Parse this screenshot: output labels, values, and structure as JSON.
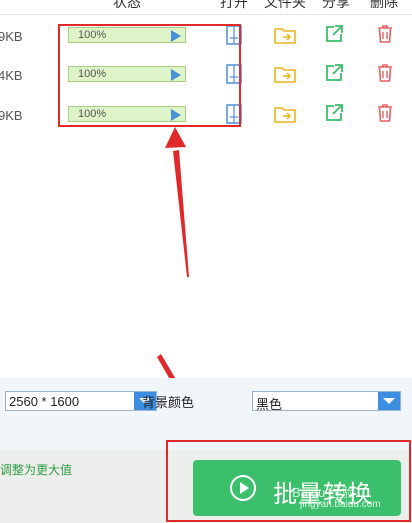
{
  "header": {
    "col_status": "状态",
    "col_open": "打开",
    "col_folder": "文件夹",
    "col_share": "分享",
    "col_delete": "删除"
  },
  "rows": [
    {
      "size": "9KB",
      "progress_text": "100%",
      "progress": 1.0
    },
    {
      "size": "4KB",
      "progress_text": "100%",
      "progress": 1.0
    },
    {
      "size": "9KB",
      "progress_text": "100%",
      "progress": 1.0
    }
  ],
  "icons": {
    "open": "open-file-icon",
    "folder": "folder-icon",
    "share": "share-icon",
    "delete": "trash-icon"
  },
  "settings": {
    "resolution_value": "2560 * 1600",
    "bg_color_label": "背景颜色",
    "bg_color_value": "黑色"
  },
  "bottom": {
    "hint": "调整为更大值",
    "convert_label": "批量转换",
    "watermark_cn": "Baidu 经验",
    "watermark_url": "jingyan.baidu.com"
  },
  "colors": {
    "annotation_red": "#e02a2a",
    "convert_green": "#3bbf6a",
    "progress_fill": "#dff3c8",
    "dropdown_blue": "#3d8de0"
  }
}
